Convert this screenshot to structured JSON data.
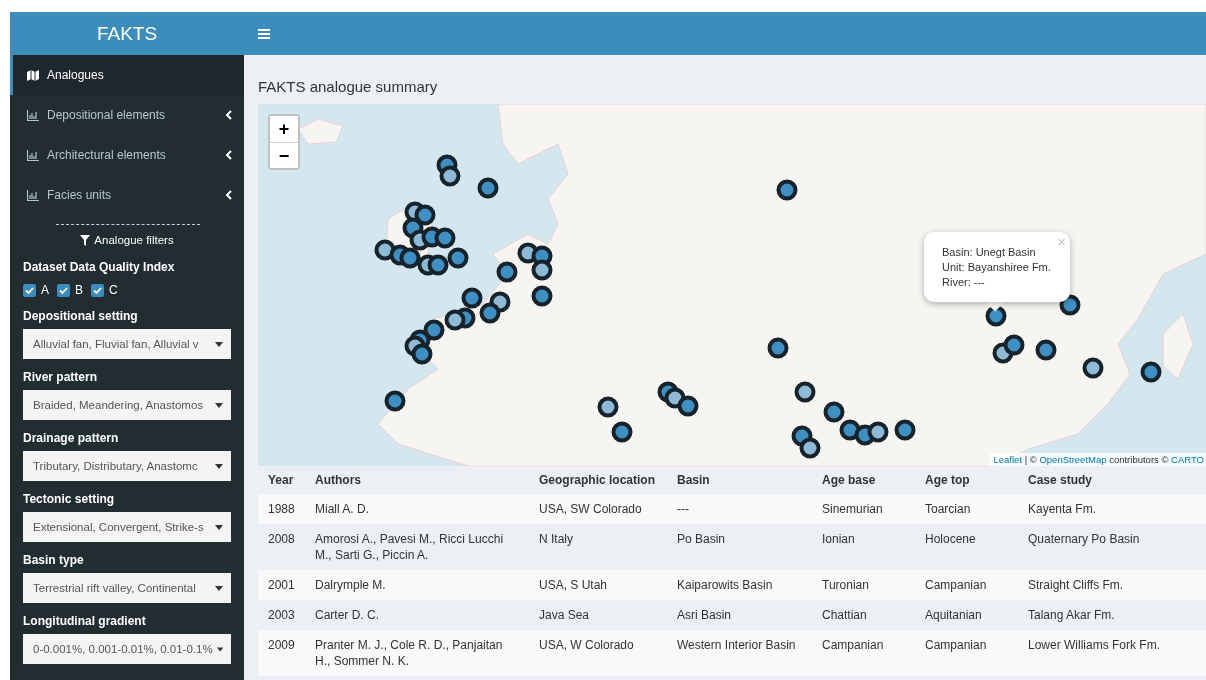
{
  "app": {
    "title": "FAKTS"
  },
  "sidebar": {
    "menu": [
      {
        "label": "Analogues",
        "kind": "page",
        "selected": true
      },
      {
        "label": "Depositional elements",
        "kind": "submenu",
        "selected": false
      },
      {
        "label": "Architectural elements",
        "kind": "submenu",
        "selected": false
      },
      {
        "label": "Facies units",
        "kind": "submenu",
        "selected": false
      }
    ],
    "filters_heading": "Analogue filters",
    "quality": {
      "label": "Dataset Data Quality Index",
      "options": [
        {
          "label": "A",
          "checked": true
        },
        {
          "label": "B",
          "checked": true
        },
        {
          "label": "C",
          "checked": true
        }
      ]
    },
    "filters": [
      {
        "label": "Depositional setting",
        "value": "Alluvial fan, Fluvial fan, Alluvial v"
      },
      {
        "label": "River pattern",
        "value": "Braided, Meandering, Anastomos"
      },
      {
        "label": "Drainage pattern",
        "value": "Tributary, Distributary, Anastomc"
      },
      {
        "label": "Tectonic setting",
        "value": "Extensional, Convergent, Strike-s"
      },
      {
        "label": "Basin type",
        "value": "Terrestrial rift valley, Continental"
      },
      {
        "label": "Longitudinal gradient",
        "value": "0-0.001%, 0.001-0.01%, 0.01-0.1%"
      }
    ]
  },
  "page_title": "FAKTS analogue summary",
  "map": {
    "zoom_in": "+",
    "zoom_out": "−",
    "popup": {
      "close": "×",
      "lines": [
        "Basin: Unegt Basin",
        "Unit: Bayanshiree Fm.",
        "River: ---"
      ]
    },
    "attribution": [
      {
        "text": "Leaflet",
        "link": true
      },
      {
        "text": " | © ",
        "link": false
      },
      {
        "text": "OpenStreetMap",
        "link": true
      },
      {
        "text": " contributors © ",
        "link": false
      },
      {
        "text": "CARTO",
        "link": true
      }
    ]
  },
  "table": {
    "columns": [
      "Year",
      "Authors",
      "Geographic location",
      "Basin",
      "Age base",
      "Age top",
      "Case study"
    ],
    "rows": [
      [
        "1988",
        "Miall A. D.",
        "USA, SW Colorado",
        "---",
        "Sinemurian",
        "Toarcian",
        "Kayenta Fm."
      ],
      [
        "2008",
        "Amorosi A., Pavesi M., Ricci Lucchi M., Sarti G., Piccin A.",
        "N Italy",
        "Po Basin",
        "Ionian",
        "Holocene",
        "Quaternary Po Basin"
      ],
      [
        "2001",
        "Dalrymple M.",
        "USA, S Utah",
        "Kaiparowits Basin",
        "Turonian",
        "Campanian",
        "Straight Cliffs Fm."
      ],
      [
        "2003",
        "Carter D. C.",
        "Java Sea",
        "Asri Basin",
        "Chattian",
        "Aquitanian",
        "Talang Akar Fm."
      ],
      [
        "2009",
        "Pranter M. J., Cole R. D., Panjaitan H., Sommer N. K.",
        "USA, W Colorado",
        "Western Interior Basin",
        "Campanian",
        "Campanian",
        "Lower Williams Fork Fm."
      ]
    ]
  }
}
